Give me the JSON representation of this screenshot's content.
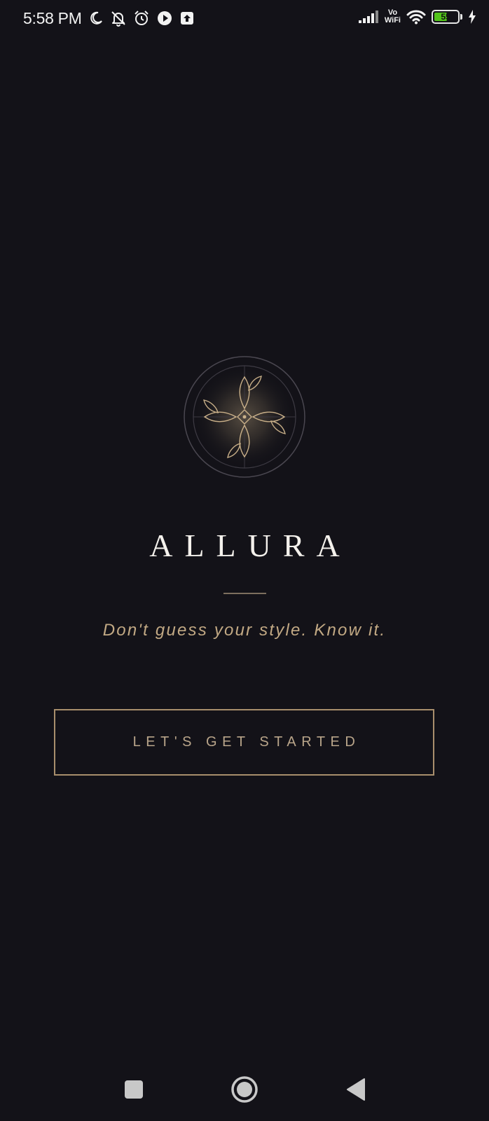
{
  "status_bar": {
    "time": "5:58 PM",
    "left_icons": [
      "moon-icon",
      "bell-off-icon",
      "alarm-icon",
      "play-icon",
      "upload-icon"
    ],
    "right_icons": [
      "signal-icon",
      "vowifi-icon",
      "wifi-icon",
      "battery-icon",
      "charging-icon"
    ],
    "vowifi_top": "Vo",
    "vowifi_bottom": "WiFi",
    "battery_level": "55"
  },
  "splash": {
    "brand": "ALLURA",
    "tagline": "Don't guess your style. Know it.",
    "start_button": "LET'S GET STARTED"
  },
  "nav_bar": {
    "buttons": [
      "recents-button",
      "home-button",
      "back-button"
    ]
  },
  "colors": {
    "background": "#131218",
    "accent_gold": "#c2a984",
    "button_border": "#a88e6c",
    "title_white": "#f4f1ec"
  }
}
